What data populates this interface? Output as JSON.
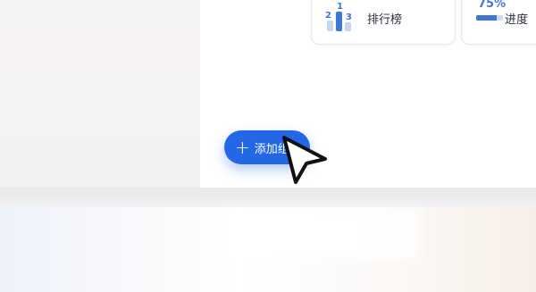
{
  "cards": {
    "ranking": {
      "label": "排行榜",
      "ranks": [
        "2",
        "1",
        "3"
      ]
    },
    "progress": {
      "value_text": "75%",
      "value": 0.75,
      "label": "进度"
    }
  },
  "fab": {
    "label": "添加组件",
    "icon": "plus-icon"
  },
  "colors": {
    "accent": "#2367e6",
    "progress": "#3f76d9",
    "progress_track": "#c9dbf7"
  }
}
